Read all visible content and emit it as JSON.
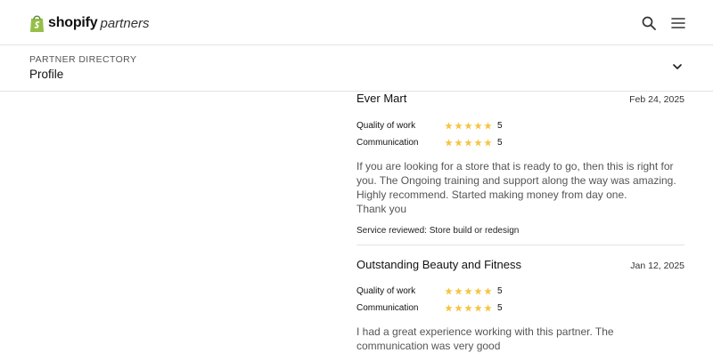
{
  "header": {
    "brand": "shopify",
    "brand_suffix": "partners",
    "icons": [
      "search-icon",
      "menu-icon"
    ]
  },
  "subheader": {
    "eyebrow": "PARTNER DIRECTORY",
    "title": "Profile"
  },
  "colors": {
    "star": "#f5c442",
    "logo_green": "#95bf47",
    "divider": "#e3e3e3"
  },
  "reviews": [
    {
      "name": "Ever Mart",
      "date": "Feb 24, 2025",
      "ratings": [
        {
          "label": "Quality of work",
          "value": "5",
          "stars": 5
        },
        {
          "label": "Communication",
          "value": "5",
          "stars": 5
        }
      ],
      "body": [
        "If you are looking for a store that is ready to go, then this is right for you. The Ongoing training and support along the way was amazing. Highly recommend. Started making money from day one.",
        "Thank you"
      ],
      "service": "Service reviewed: Store build or redesign"
    },
    {
      "name": "Outstanding Beauty and Fitness",
      "date": "Jan 12, 2025",
      "ratings": [
        {
          "label": "Quality of work",
          "value": "5",
          "stars": 5
        },
        {
          "label": "Communication",
          "value": "5",
          "stars": 5
        }
      ],
      "body": [
        "I had a great experience working with this partner. The communication was very good"
      ]
    }
  ]
}
